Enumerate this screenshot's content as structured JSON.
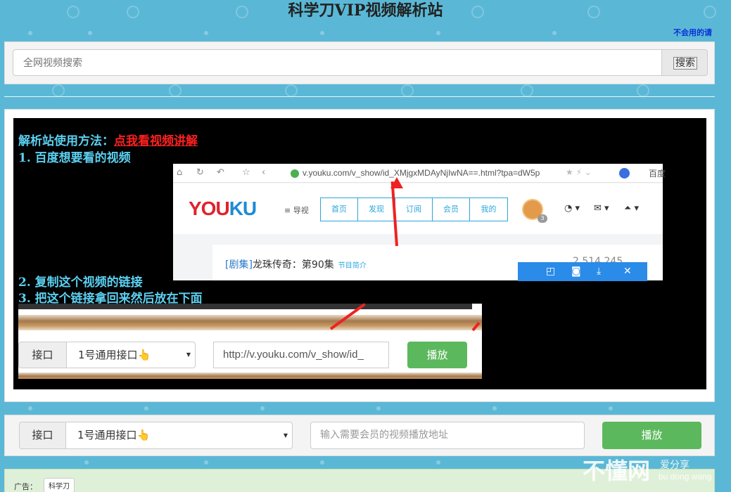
{
  "site": {
    "title": "科学刀VIP视频解析站",
    "top_right_link": "不会用的请"
  },
  "search": {
    "placeholder": "全网视频搜索",
    "button_label": "搜索"
  },
  "tutorial": {
    "line1_prefix": "解析站使用方法：",
    "line1_link": "点我看视频讲解",
    "step1": "1. 百度想要看的视频",
    "step2": "2. 复制这个视频的链接",
    "step3": "3. 把这个链接拿回来然后放在下面",
    "browser": {
      "url": "v.youku.com/v_show/id_XMjgxMDAyNjIwNA==.html?tpa=dW5p",
      "right_text": "百度",
      "logo_a": "YOU",
      "logo_b": "KU",
      "guide": "≡ 导视",
      "tabs": [
        "首页",
        "发现",
        "订阅",
        "会员",
        "我的"
      ],
      "avatar_badge": "3",
      "episode_category": "[剧集]",
      "episode_title": "龙珠传奇：第90集",
      "episode_intro": "节目简介",
      "views": "2,514,245"
    },
    "form": {
      "label": "接口",
      "select_value": "1号通用接口👆",
      "url_value": "http://v.youku.com/v_show/id_",
      "play_label": "播放"
    }
  },
  "player": {
    "label": "接口",
    "select_value": "1号通用接口👆",
    "url_placeholder": "输入需要会员的视频播放地址",
    "play_label": "播放"
  },
  "ad": {
    "label": "广告：",
    "tag": "科学刀"
  },
  "watermark": {
    "main": "不懂网",
    "sub": "爱分享",
    "pinyin": "bu dong wang"
  },
  "colors": {
    "background": "#5ab8d6",
    "accent_green": "#5cb85c",
    "tutorial_text": "#5bd0f0",
    "link_red": "#ff2020"
  }
}
